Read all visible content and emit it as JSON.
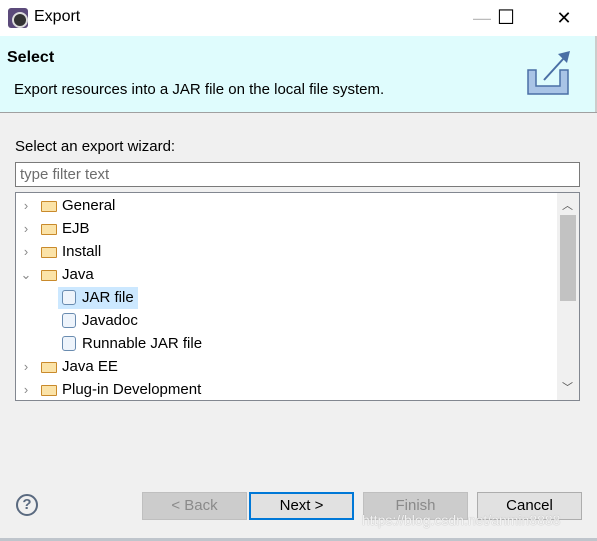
{
  "window": {
    "title": "Export",
    "minimize": "—",
    "maximize": "☐",
    "close": "✕"
  },
  "header": {
    "title": "Select",
    "description": "Export resources into a JAR file on the local file system.",
    "icon": "export-icon"
  },
  "wizard_label": "Select an export wizard:",
  "filter": {
    "placeholder": "type filter text",
    "value": ""
  },
  "tree": [
    {
      "label": "General",
      "level": 0,
      "expanded": false,
      "icon": "folder-icon"
    },
    {
      "label": "EJB",
      "level": 0,
      "expanded": false,
      "icon": "folder-icon"
    },
    {
      "label": "Install",
      "level": 0,
      "expanded": false,
      "icon": "folder-icon"
    },
    {
      "label": "Java",
      "level": 0,
      "expanded": true,
      "icon": "folder-icon"
    },
    {
      "label": "JAR file",
      "level": 1,
      "selected": true,
      "icon": "jar-icon"
    },
    {
      "label": "Javadoc",
      "level": 1,
      "icon": "javadoc-icon"
    },
    {
      "label": "Runnable JAR file",
      "level": 1,
      "icon": "runnable-jar-icon"
    },
    {
      "label": "Java EE",
      "level": 0,
      "expanded": false,
      "icon": "folder-icon"
    },
    {
      "label": "Plug-in Development",
      "level": 0,
      "expanded": false,
      "icon": "folder-icon"
    }
  ],
  "buttons": {
    "back": "< Back",
    "next": "Next >",
    "finish": "Finish",
    "cancel": "Cancel",
    "help": "?"
  },
  "watermark": "https://blog.csdn.net/anmin8888"
}
